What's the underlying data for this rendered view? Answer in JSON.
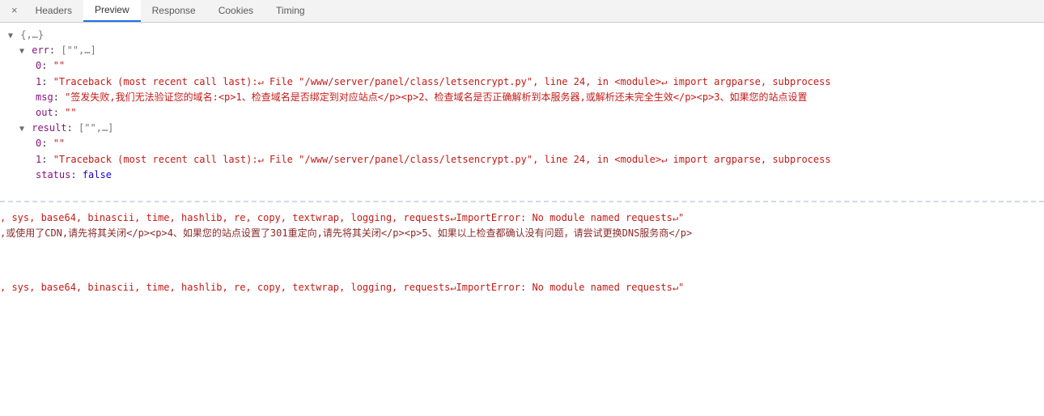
{
  "tabs": {
    "close": "×",
    "headers": "Headers",
    "preview": "Preview",
    "response": "Response",
    "cookies": "Cookies",
    "timing": "Timing"
  },
  "json": {
    "root": "{,…}",
    "err_key": "err",
    "err_summary": "[\"\",…]",
    "err_0_key": "0",
    "err_0_val": "\"\"",
    "err_1_key": "1",
    "err_1_val": "\"Traceback (most recent call last):↵  File \"/www/server/panel/class/letsencrypt.py\", line 24, in <module>↵    import argparse, subprocess",
    "msg_key": "msg",
    "msg_val": "\"签发失败,我们无法验证您的域名:<p>1、检查域名是否绑定到对应站点</p><p>2、检查域名是否正确解析到本服务器,或解析还未完全生效</p><p>3、如果您的站点设置",
    "out_key": "out",
    "out_val": "\"\"",
    "result_key": "result",
    "result_summary": "[\"\",…]",
    "result_0_key": "0",
    "result_0_val": "\"\"",
    "result_1_key": "1",
    "result_1_val": "\"Traceback (most recent call last):↵  File \"/www/server/panel/class/letsencrypt.py\", line 24, in <module>↵    import argparse, subprocess",
    "status_key": "status",
    "status_val": "false"
  },
  "overflow": {
    "line1": ", sys, base64, binascii, time, hashlib, re, copy, textwrap, logging, requests↵ImportError: No module named requests↵\"",
    "line2": ",或使用了CDN,请先将其关闭</p><p>4、如果您的站点设置了301重定向,请先将其关闭</p><p>5、如果以上检查都确认没有问题，请尝试更换DNS服务商</p>",
    "line3": ", sys, base64, binascii, time, hashlib, re, copy, textwrap, logging, requests↵ImportError: No module named requests↵\""
  }
}
